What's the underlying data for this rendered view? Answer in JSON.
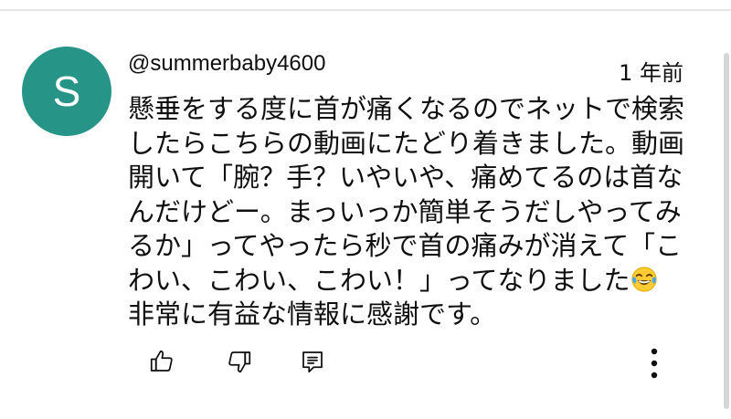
{
  "avatar": {
    "letter": "S",
    "color": "#279488"
  },
  "author": {
    "handle": "@summerbaby4600"
  },
  "timestamp": "1 年前",
  "comment": {
    "lines": [
      "懸垂をする度に首が痛くなるのでネットで検索",
      "したらこちらの動画にたどり着きました。動画",
      "開いて「腕？手？いやいや、痛めてるのは首な",
      "んだけどー。まっいっか簡単そうだしやってみ",
      "るか」ってやったら秒で首の痛みが消えて「こ",
      "わい、こわい、こわい！」ってなりました",
      "非常に有益な情報に感謝です。"
    ],
    "emoji": "face-with-tears-of-joy"
  },
  "actions": {
    "like_icon": "thumbs-up-icon",
    "dislike_icon": "thumbs-down-icon",
    "reply_icon": "reply-comment-icon",
    "more_icon": "more-vertical-icon"
  }
}
